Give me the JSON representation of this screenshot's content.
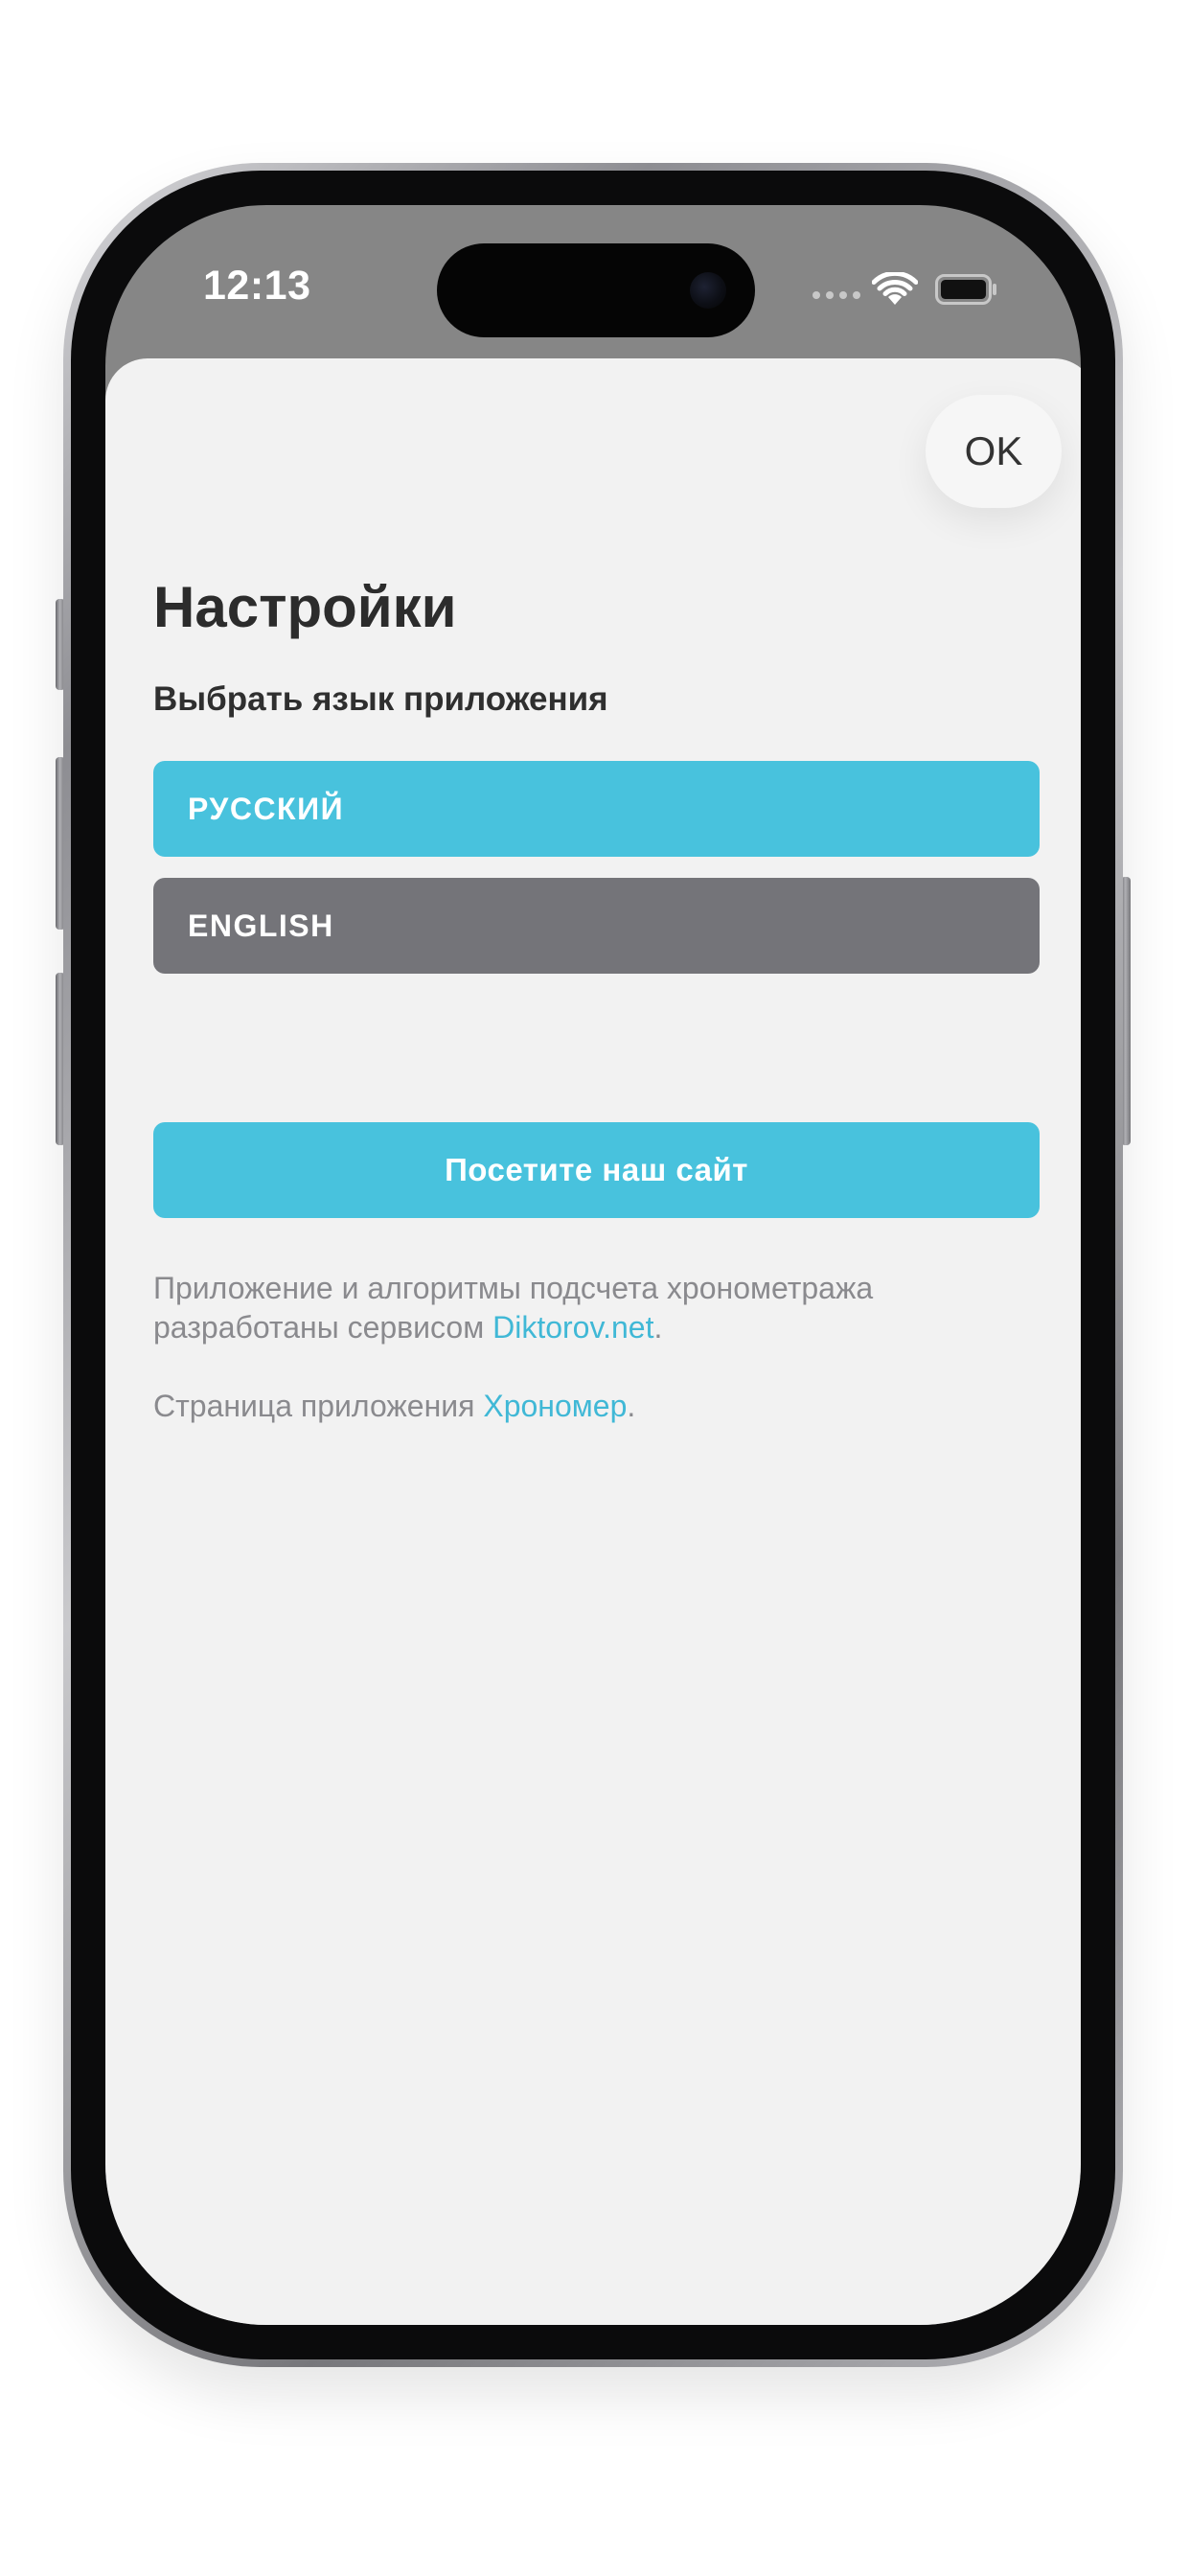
{
  "status_bar": {
    "time": "12:13"
  },
  "sheet": {
    "ok_label": "OK",
    "title": "Настройки",
    "language_section_label": "Выбрать язык приложения",
    "languages": [
      {
        "label": "РУССКИЙ",
        "selected": true
      },
      {
        "label": "ENGLISH",
        "selected": false
      }
    ],
    "site_button_label": "Посетите наш сайт",
    "developer_text_prefix": "Приложение и алгоритмы подсчета хронометража разработаны сервисом ",
    "developer_link": "Diktorov.net",
    "developer_text_suffix": ".",
    "app_page_prefix": "Страница приложения ",
    "app_page_link": "Хрономер",
    "app_page_suffix": "."
  },
  "colors": {
    "accent": "#48c2dd",
    "unselected_button": "#747479",
    "link": "#40b8d6",
    "sheet_background": "#f2f2f2"
  },
  "icons": [
    "wifi-icon",
    "battery-icon",
    "signal-dots-icon",
    "camera-icon"
  ]
}
